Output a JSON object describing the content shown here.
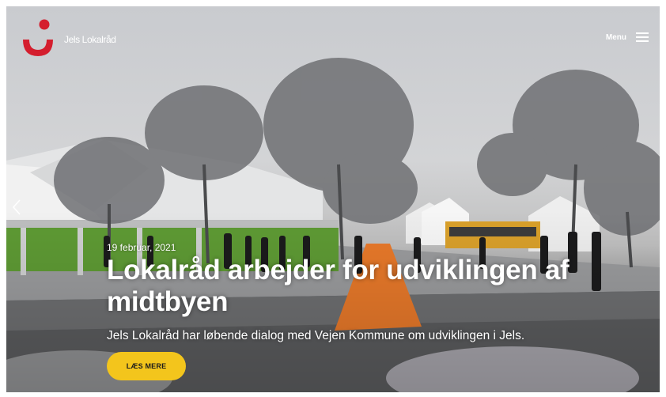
{
  "header": {
    "brand_name": "Jels Lokalråd",
    "menu_label": "Menu",
    "logo_color": "#d41e2e"
  },
  "slide": {
    "date": "19 februar, 2021",
    "title": "Lokalråd arbejder for udviklingen af midtbyen",
    "subtitle": "Jels Lokalråd har løbende dialog med Vejen Kommune om udviklingen i Jels.",
    "button_label": "LÆS MERE",
    "button_color": "#f3c51c"
  },
  "icons": {
    "menu": "hamburger-icon",
    "previous": "chevron-left-icon",
    "logo": "jels-logo-icon"
  }
}
